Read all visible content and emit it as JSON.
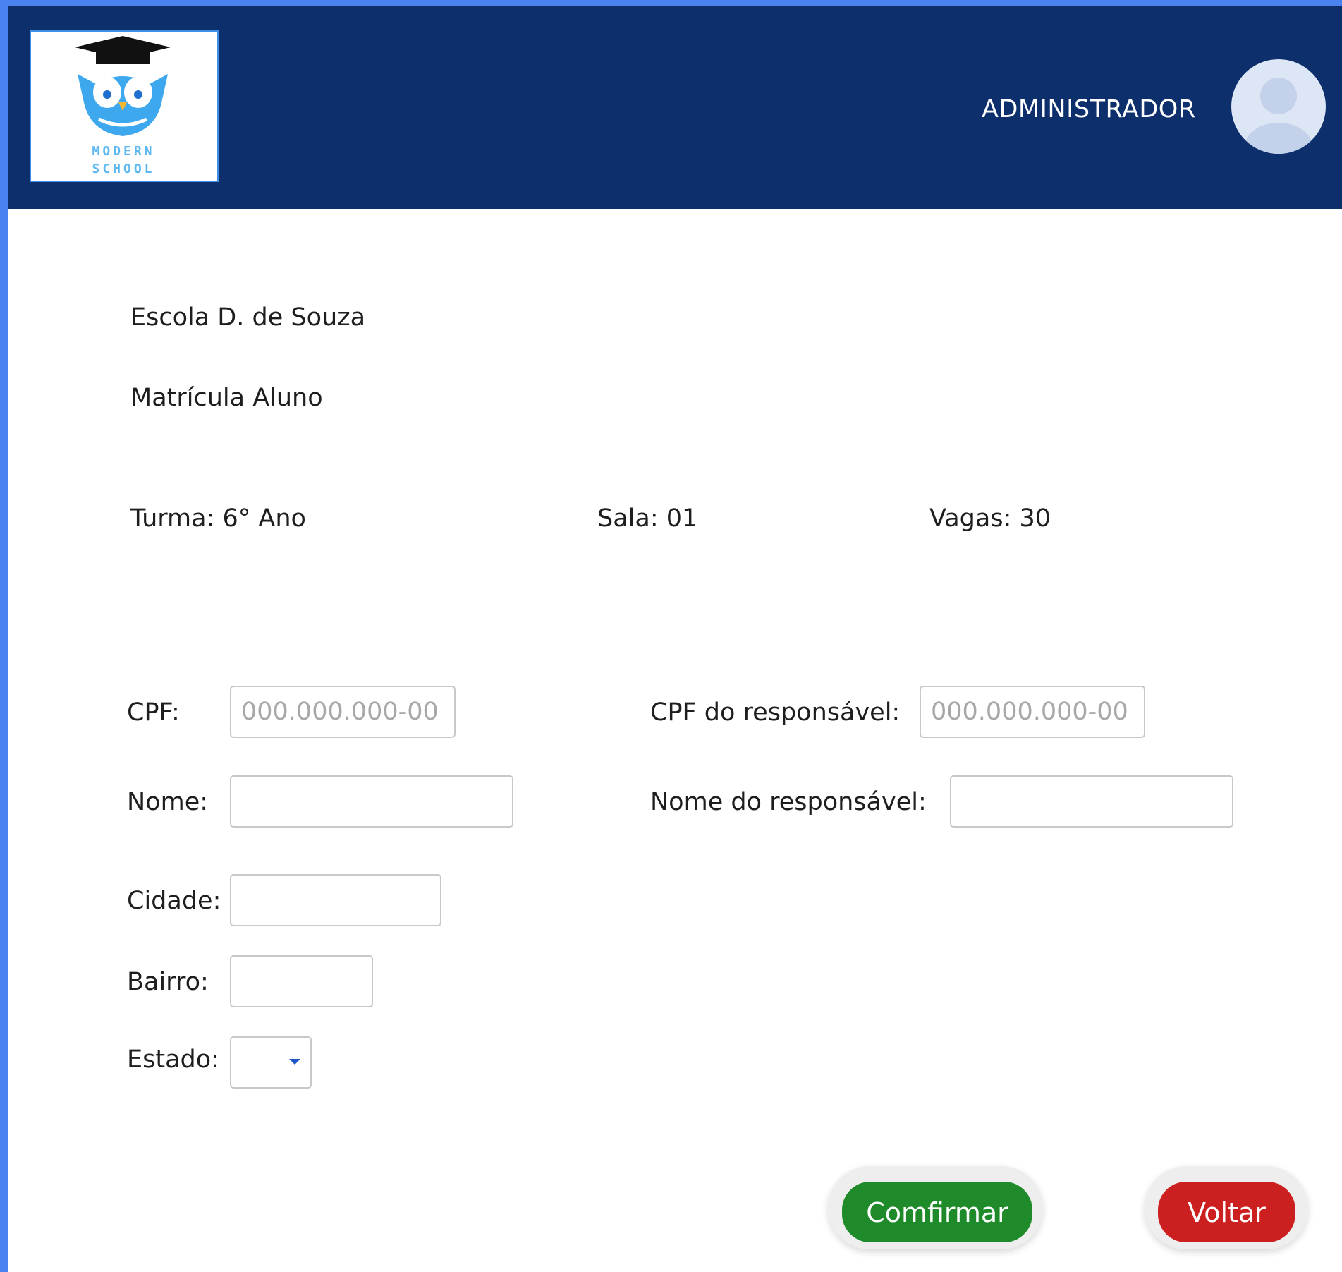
{
  "header": {
    "logo": {
      "line1": "MODERN",
      "line2": "SCHOOL",
      "icon": "owl-graduation-cap-icon"
    },
    "user_role": "ADMINISTRADOR",
    "avatar_icon": "user-avatar-icon"
  },
  "page": {
    "school_name": "Escola D. de Souza",
    "section_title": "Matrícula Aluno",
    "turma": "Turma: 6° Ano",
    "sala": "Sala: 01",
    "vagas": "Vagas: 30"
  },
  "form": {
    "cpf": {
      "label": "CPF:",
      "value": "",
      "placeholder": "000.000.000-00"
    },
    "nome": {
      "label": "Nome:",
      "value": ""
    },
    "cidade": {
      "label": "Cidade:",
      "value": ""
    },
    "bairro": {
      "label": "Bairro:",
      "value": ""
    },
    "estado": {
      "label": "Estado:",
      "selected": ""
    },
    "cpf_responsavel": {
      "label": "CPF do responsável:",
      "value": "",
      "placeholder": "000.000.000-00"
    },
    "nome_responsavel": {
      "label": "Nome do responsável:",
      "value": ""
    }
  },
  "actions": {
    "confirm_label": "Comfirmar",
    "back_label": "Voltar"
  },
  "colors": {
    "header_bg": "#0d306c",
    "frame_border": "#4a83f0",
    "confirm_bg": "#1f8a2a",
    "back_bg": "#cc1f1f",
    "logo_accent": "#3ea8ef"
  }
}
